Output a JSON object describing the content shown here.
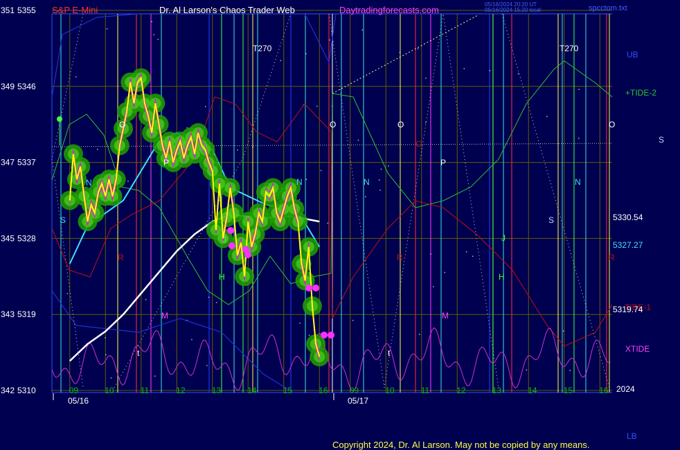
{
  "header": {
    "instrument": "S&P E-Mini",
    "site_title": "Dr. Al Larson's Chaos Trader Web",
    "site_url": "Daytradingforecasts.com",
    "stamp_line1": "05/16/2024 20:20 UT",
    "stamp_line2": "05/16/2024 15:20 local",
    "filename": "spcctom.txt"
  },
  "footer": {
    "copyright": "Copyright 2024, Dr. Al Larson. May not be copied by any means."
  },
  "colors": {
    "background": "#000050",
    "price": "#ffff00",
    "bands": "#ff00ff",
    "green_cloud": "#22aa00",
    "ma_cyan": "#40e0ff",
    "ma_white": "#ffffff",
    "tide2": "#30c030",
    "tide1": "#c01010",
    "xtide": "#d030d0",
    "ub_lb_band": "#2030d0",
    "forecast_dotted": "#d8d8d8",
    "grid": "#606000"
  },
  "chart_data": {
    "type": "line",
    "title": "S&P E-Mini",
    "xlabel": "",
    "ylabel": "",
    "y_left_labels": [
      {
        "code": "351",
        "price": "5355"
      },
      {
        "code": "349",
        "price": "5346"
      },
      {
        "code": "347",
        "price": "5337"
      },
      {
        "code": "345",
        "price": "5328"
      },
      {
        "code": "343",
        "price": "5319"
      },
      {
        "code": "342",
        "price": "5310"
      }
    ],
    "ylim": [
      5310,
      5355
    ],
    "x_hours_day1": [
      "09",
      "10",
      "11",
      "12",
      "13",
      "14",
      "15",
      "16"
    ],
    "x_hours_day2": [
      "09",
      "10",
      "11",
      "12",
      "13",
      "14",
      "15",
      "16"
    ],
    "dates": [
      "05/16",
      "05/17"
    ],
    "year_label": "2024",
    "right_labels": {
      "ub": "UB",
      "tide2": "+TIDE-2",
      "s": "S",
      "tide1": "TIDE-1",
      "xtide": "XTIDE",
      "lb": "LB",
      "val1": "5330.54",
      "val2": "5327.27",
      "val3": "5319.74"
    },
    "markers_day1": [
      "T270",
      "O",
      "P",
      "N",
      "S",
      "R",
      "J",
      "H",
      "M",
      "t",
      "N"
    ],
    "markers_day2": [
      "T270",
      "O",
      "O",
      "O",
      "C",
      "P",
      "N",
      "N",
      "S",
      "R",
      "R",
      "J",
      "H",
      "M",
      "t"
    ],
    "price_series": {
      "name": "price",
      "hours": [
        9.0,
        9.1,
        9.2,
        9.3,
        9.4,
        9.5,
        9.6,
        9.7,
        9.8,
        9.9,
        10.0,
        10.1,
        10.2,
        10.3,
        10.4,
        10.5,
        10.6,
        10.7,
        10.8,
        10.9,
        11.0,
        11.1,
        11.2,
        11.3,
        11.4,
        11.5,
        11.6,
        11.7,
        11.8,
        11.9,
        12.0,
        12.1,
        12.2,
        12.3,
        12.4,
        12.5,
        12.6,
        12.7,
        12.8,
        12.9,
        13.0,
        13.1,
        13.2,
        13.3,
        13.4,
        13.5,
        13.6,
        13.7,
        13.8,
        13.9,
        14.0,
        14.1,
        14.2,
        14.3,
        14.4,
        14.5,
        14.6,
        14.7,
        14.8,
        14.9,
        15.0,
        15.1,
        15.2,
        15.3,
        15.4,
        15.5,
        15.6,
        15.7,
        15.8,
        15.9,
        16.0
      ],
      "values": [
        5332.5,
        5338.0,
        5335.0,
        5336.5,
        5333.0,
        5330.0,
        5332.0,
        5331.0,
        5333.5,
        5334.5,
        5333.0,
        5335.0,
        5333.0,
        5335.0,
        5339.0,
        5341.0,
        5343.0,
        5346.5,
        5344.0,
        5346.5,
        5347.0,
        5344.0,
        5342.5,
        5340.5,
        5344.0,
        5341.5,
        5339.0,
        5337.5,
        5339.5,
        5337.0,
        5338.5,
        5339.5,
        5337.5,
        5339.0,
        5340.0,
        5338.0,
        5340.5,
        5339.0,
        5338.5,
        5337.0,
        5336.0,
        5329.0,
        5334.5,
        5328.0,
        5330.5,
        5334.0,
        5331.0,
        5326.0,
        5327.5,
        5323.5,
        5330.0,
        5327.0,
        5328.5,
        5331.0,
        5330.0,
        5333.5,
        5333.0,
        5334.0,
        5331.0,
        5330.0,
        5331.5,
        5333.0,
        5334.0,
        5331.5,
        5330.0,
        5325.0,
        5323.0,
        5327.0,
        5320.0,
        5315.5,
        5314.0
      ]
    },
    "ma_cyan": {
      "hours": [
        9.0,
        9.5,
        10.0,
        10.5,
        11.0,
        11.5,
        12.0,
        12.5,
        13.0,
        13.5,
        14.0,
        14.5,
        15.0,
        15.5,
        16.0
      ],
      "values": [
        5325.0,
        5329.5,
        5331.0,
        5332.5,
        5336.0,
        5339.5,
        5340.5,
        5339.0,
        5338.5,
        5334.0,
        5333.0,
        5332.0,
        5331.5,
        5330.5,
        5327.0
      ]
    },
    "ma_white": {
      "hours": [
        9.0,
        9.5,
        10.0,
        10.5,
        11.0,
        11.5,
        12.0,
        12.5,
        13.0,
        13.5,
        14.0,
        14.5,
        15.0,
        15.5,
        16.0
      ],
      "values": [
        5313.5,
        5315.5,
        5317.0,
        5319.0,
        5321.5,
        5324.0,
        5326.5,
        5328.5,
        5330.0,
        5330.8,
        5330.6,
        5330.4,
        5330.7,
        5330.4,
        5330.0
      ]
    }
  }
}
